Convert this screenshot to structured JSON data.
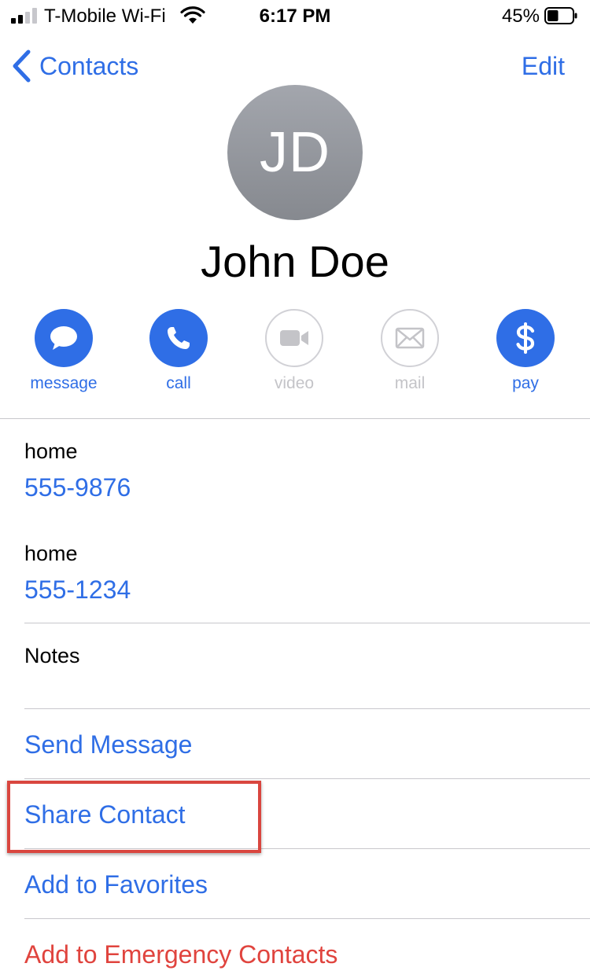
{
  "status_bar": {
    "carrier": "T-Mobile Wi-Fi",
    "time": "6:17 PM",
    "battery_percent": "45%",
    "battery_level": 0.45,
    "signal_bars_filled": 2,
    "signal_bars_total": 4
  },
  "nav": {
    "back_label": "Contacts",
    "edit_label": "Edit"
  },
  "contact": {
    "initials": "JD",
    "name": "John Doe"
  },
  "actions": [
    {
      "label": "message",
      "icon": "message-bubble-icon",
      "enabled": true
    },
    {
      "label": "call",
      "icon": "phone-icon",
      "enabled": true
    },
    {
      "label": "video",
      "icon": "video-camera-icon",
      "enabled": false
    },
    {
      "label": "mail",
      "icon": "envelope-icon",
      "enabled": false
    },
    {
      "label": "pay",
      "icon": "dollar-icon",
      "enabled": true
    }
  ],
  "phones": [
    {
      "label": "home",
      "number": "555-9876"
    },
    {
      "label": "home",
      "number": "555-1234"
    }
  ],
  "notes_label": "Notes",
  "options": {
    "send_message": "Send Message",
    "share_contact": "Share Contact",
    "add_favorites": "Add to Favorites",
    "add_emergency": "Add to Emergency Contacts"
  },
  "colors": {
    "accent": "#2f6ee6",
    "danger": "#e0443e",
    "highlight": "#d9463f",
    "disabled": "#c4c4c8"
  }
}
